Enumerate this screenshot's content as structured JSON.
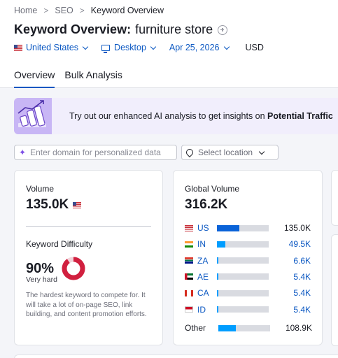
{
  "breadcrumb": [
    "Home",
    "SEO",
    "Keyword Overview"
  ],
  "title": {
    "label": "Keyword Overview:",
    "keyword": "furniture store"
  },
  "filters": {
    "country": "United States",
    "device": "Desktop",
    "date": "Apr 25, 2026",
    "currency": "USD"
  },
  "tabs": [
    "Overview",
    "Bulk Analysis"
  ],
  "banner": {
    "text": "Try out our enhanced AI analysis to get insights on ",
    "bold": "Potential Traffic"
  },
  "domain_input": {
    "placeholder": "Enter domain for personalized data"
  },
  "location_select": {
    "placeholder": "Select location"
  },
  "volume_card": {
    "volume_label": "Volume",
    "volume_value": "135.0K",
    "kd_label": "Keyword Difficulty",
    "kd_value": "90%",
    "kd_percent": 90,
    "kd_level": "Very hard",
    "kd_description": "The hardest keyword to compete for. It will take a lot of on-page SEO, link building, and content promotion efforts."
  },
  "global_card": {
    "label": "Global Volume",
    "value": "316.2K",
    "rows": [
      {
        "code": "US",
        "value": "135.0K",
        "share": 0.43,
        "flag": "us",
        "dark": true,
        "bar_color": "#0a63d8"
      },
      {
        "code": "IN",
        "value": "49.5K",
        "share": 0.16,
        "flag": "in",
        "dark": false,
        "bar_color": "#009dff"
      },
      {
        "code": "ZA",
        "value": "6.6K",
        "share": 0.03,
        "flag": "za",
        "dark": false,
        "bar_color": "#009dff"
      },
      {
        "code": "AE",
        "value": "5.4K",
        "share": 0.03,
        "flag": "ae",
        "dark": false,
        "bar_color": "#009dff"
      },
      {
        "code": "CA",
        "value": "5.4K",
        "share": 0.03,
        "flag": "ca",
        "dark": false,
        "bar_color": "#009dff"
      },
      {
        "code": "ID",
        "value": "5.4K",
        "share": 0.03,
        "flag": "id",
        "dark": false,
        "bar_color": "#009dff"
      }
    ],
    "other": {
      "label": "Other",
      "value": "108.9K",
      "share": 0.34
    }
  },
  "colors": {
    "accent": "#0a57c2",
    "kd_red": "#d1203f",
    "banner_bg": "#f1eefc"
  }
}
